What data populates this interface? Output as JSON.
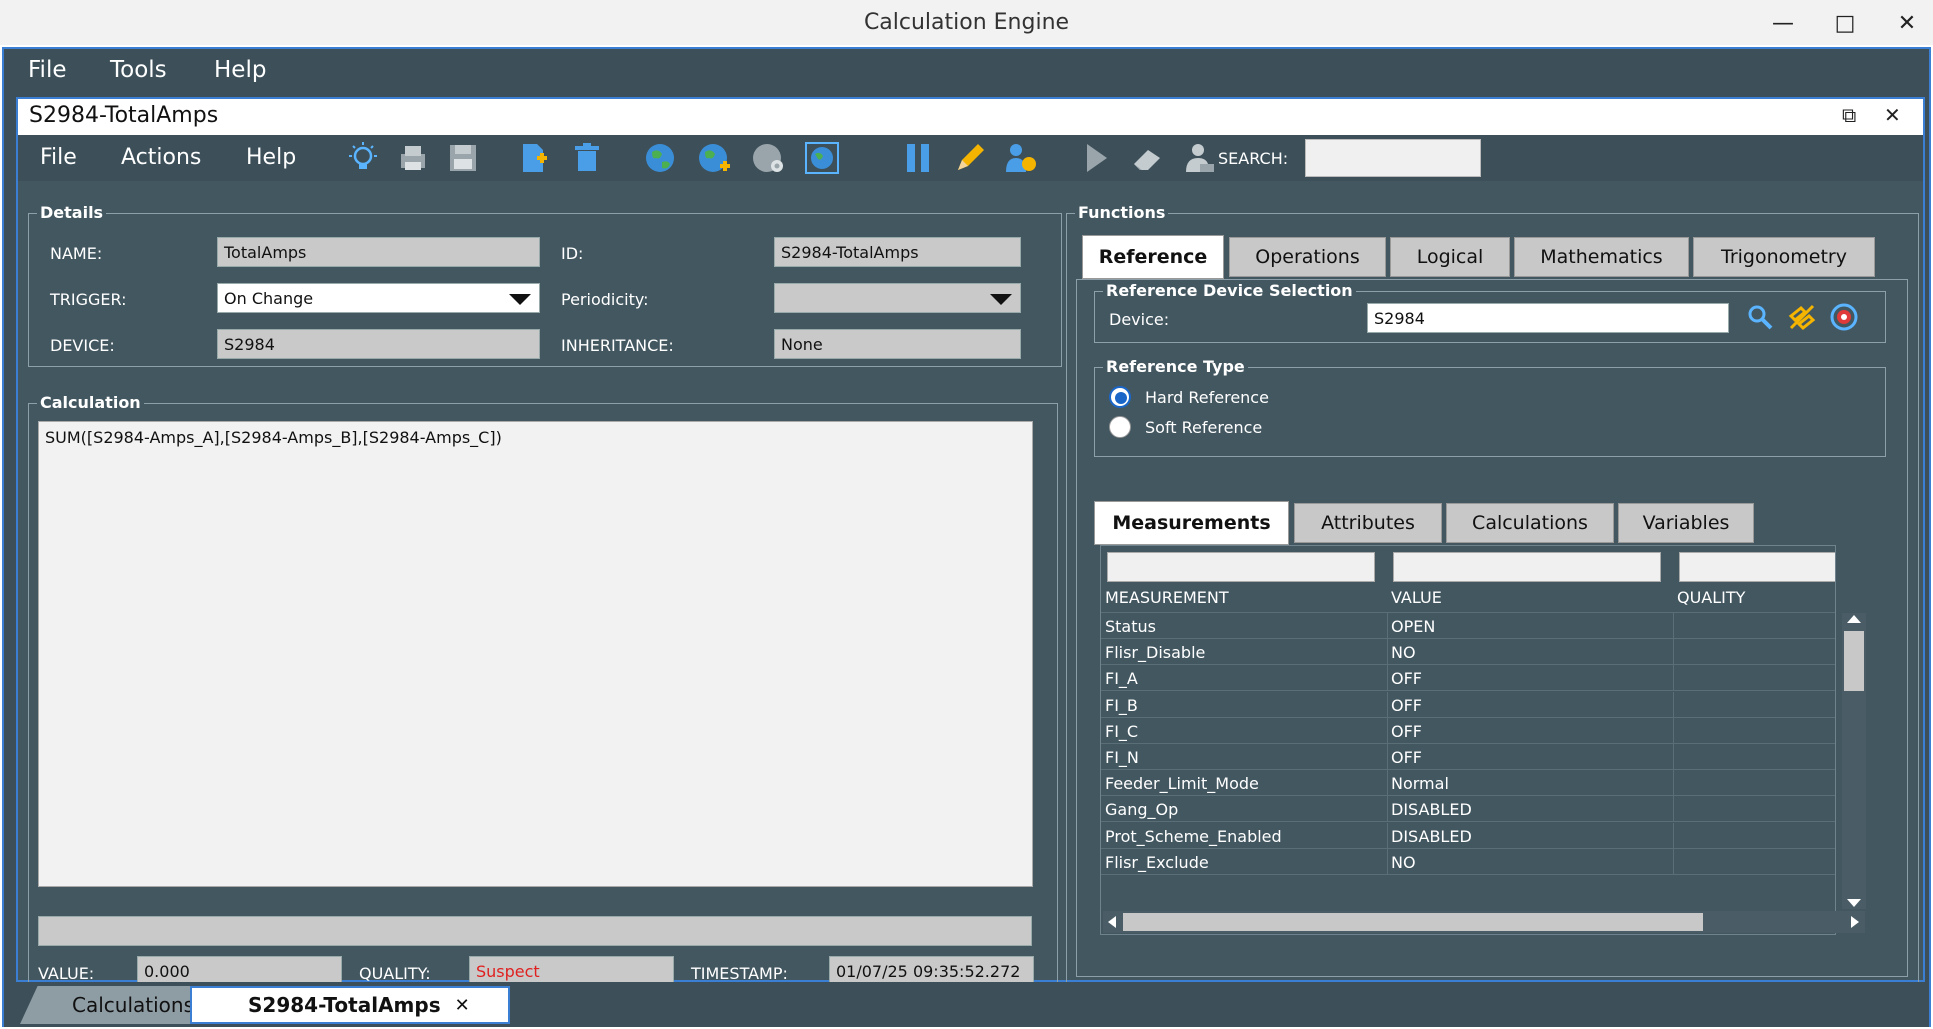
{
  "os": {
    "title": "Calculation Engine",
    "min_glyph": "—",
    "max_glyph": "□",
    "close_glyph": "✕"
  },
  "menubar": {
    "file": "File",
    "tools": "Tools",
    "help": "Help"
  },
  "doc": {
    "title": "S2984-TotalAmps",
    "restore_glyph": "⧉",
    "close_glyph": "✕",
    "menu": {
      "file": "File",
      "actions": "Actions",
      "help": "Help"
    },
    "search_label": "SEARCH:",
    "search_value": ""
  },
  "details": {
    "group_label": "Details",
    "name_label": "NAME:",
    "name_value": "TotalAmps",
    "id_label": "ID:",
    "id_value": "S2984-TotalAmps",
    "trigger_label": "TRIGGER:",
    "trigger_value": "On Change",
    "periodicity_label": "Periodicity:",
    "periodicity_value": "",
    "device_label": "DEVICE:",
    "device_value": "S2984",
    "inheritance_label": "INHERITANCE:",
    "inheritance_value": "None"
  },
  "calculation": {
    "group_label": "Calculation",
    "formula": "SUM([S2984-Amps_A],[S2984-Amps_B],[S2984-Amps_C])",
    "value_label": "VALUE:",
    "value": "0.000",
    "quality_label": "QUALITY:",
    "quality": "Suspect",
    "timestamp_label": "TIMESTAMP:",
    "timestamp": "01/07/25 09:35:52.272"
  },
  "functions": {
    "group_label": "Functions",
    "tabs": [
      "Reference",
      "Operations",
      "Logical",
      "Mathematics",
      "Trigonometry"
    ],
    "ref_device_group": "Reference Device Selection",
    "device_label": "Device:",
    "device_value": "S2984",
    "ref_type_group": "Reference Type",
    "hard_ref": "Hard Reference",
    "soft_ref": "Soft Reference"
  },
  "subtabs": [
    "Measurements",
    "Attributes",
    "Calculations",
    "Variables"
  ],
  "table": {
    "headers": [
      "MEASUREMENT",
      "VALUE",
      "QUALITY"
    ],
    "rows": [
      [
        "Status",
        "OPEN",
        ""
      ],
      [
        "Flisr_Disable",
        "NO",
        ""
      ],
      [
        "FI_A",
        "OFF",
        ""
      ],
      [
        "FI_B",
        "OFF",
        ""
      ],
      [
        "FI_C",
        "OFF",
        ""
      ],
      [
        "FI_N",
        "OFF",
        ""
      ],
      [
        "Feeder_Limit_Mode",
        "Normal",
        ""
      ],
      [
        "Gang_Op",
        "DISABLED",
        ""
      ],
      [
        "Prot_Scheme_Enabled",
        "DISABLED",
        ""
      ],
      [
        "Flisr_Exclude",
        "NO",
        ""
      ]
    ]
  },
  "bottom_tabs": {
    "calculations": "Calculations",
    "current": "S2984-TotalAmps",
    "close_glyph": "✕"
  },
  "colors": {
    "accent": "#3a7fd4",
    "panel": "#435761",
    "quality_bad": "#e02020"
  }
}
